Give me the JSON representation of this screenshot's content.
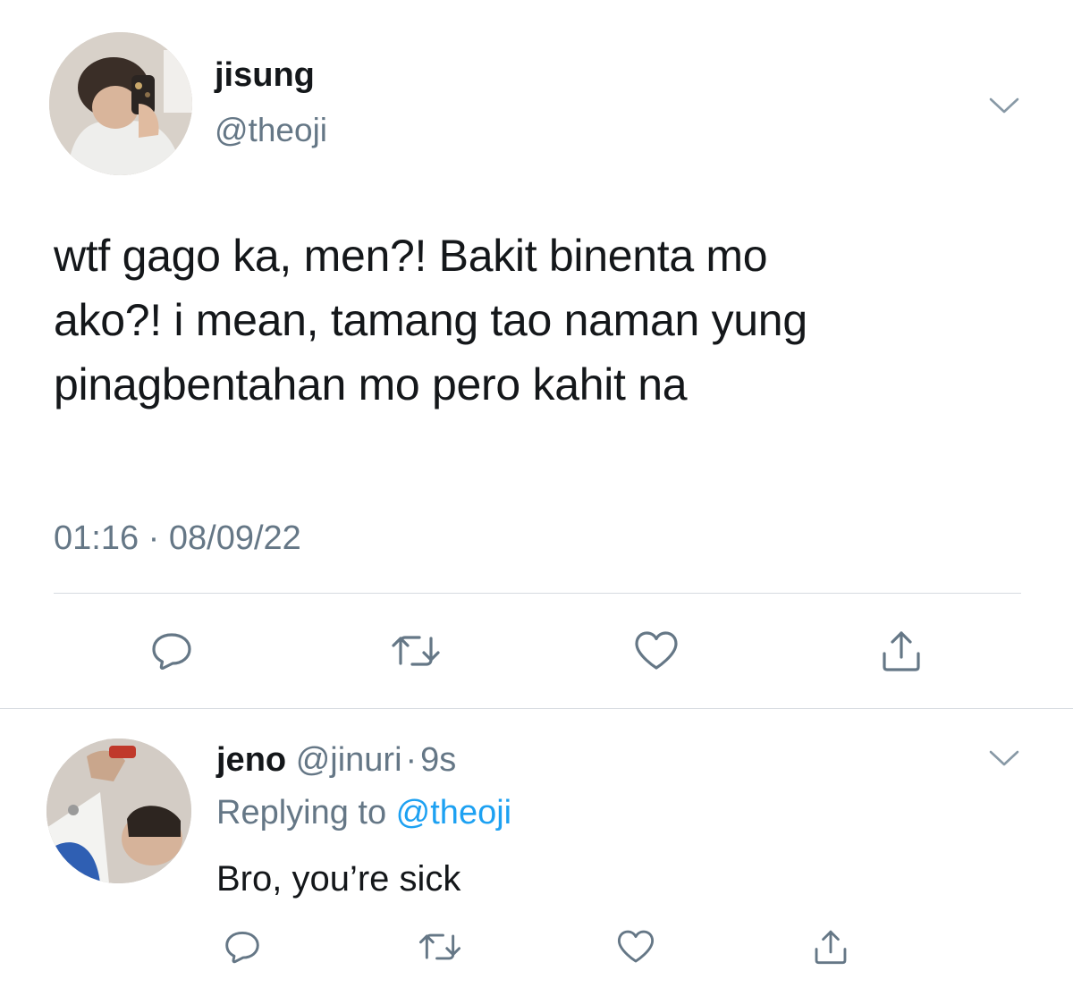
{
  "main_tweet": {
    "author_name": "jisung",
    "author_handle": "@theoji",
    "text_lines": [
      "wtf gago ka, men?! Bakit binenta mo",
      "ako?! i mean, tamang tao naman yung",
      "pinagbentahan mo pero kahit na"
    ],
    "timestamp": "01:16 · 08/09/22",
    "actions": [
      "reply-icon",
      "retweet-icon",
      "like-icon",
      "share-icon"
    ]
  },
  "reply_tweet": {
    "author_name": "jeno",
    "author_handle": "@jinuri",
    "separator": "·",
    "time_ago": "9s",
    "replying_prefix": "Replying to ",
    "replying_handle": "@theoji",
    "text": "Bro, you’re sick",
    "actions": [
      "reply-icon",
      "retweet-icon",
      "like-icon",
      "share-icon"
    ]
  },
  "colors": {
    "text_primary": "#14171a",
    "text_secondary": "#657786",
    "link": "#1da1f2",
    "icon": "#657786",
    "divider": "#d6dbe0"
  }
}
